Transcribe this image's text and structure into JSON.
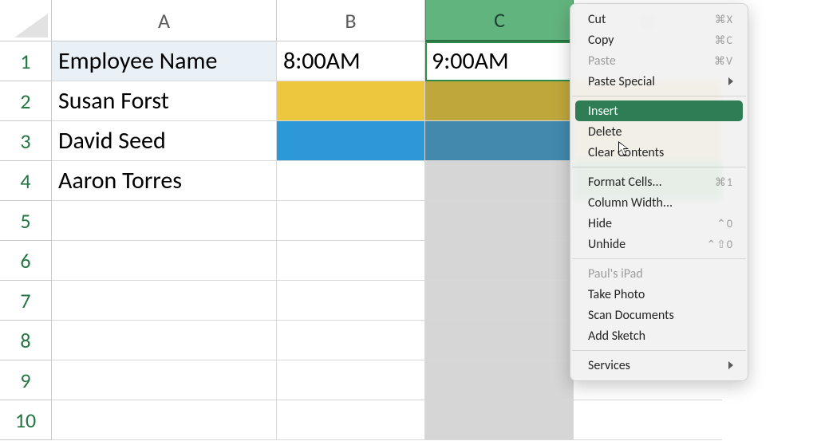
{
  "columns": {
    "A": "A",
    "B": "B",
    "C": "C",
    "D": "D"
  },
  "rows": {
    "r1": "1",
    "r2": "2",
    "r3": "3",
    "r4": "4",
    "r5": "5",
    "r6": "6",
    "r7": "7",
    "r8": "8",
    "r9": "9",
    "r10": "10"
  },
  "header_row": {
    "A": "Employee Name",
    "B": "8:00AM",
    "C": "9:00AM",
    "D": ""
  },
  "employees": {
    "r2": "Susan Forst",
    "r3": "David Seed",
    "r4": "Aaron Torres"
  },
  "selected_column": "C",
  "context_menu": {
    "cut": {
      "label": "Cut",
      "shortcut": "⌘X"
    },
    "copy": {
      "label": "Copy",
      "shortcut": "⌘C"
    },
    "paste": {
      "label": "Paste",
      "shortcut": "⌘V",
      "disabled": true
    },
    "paste_special": {
      "label": "Paste Special",
      "submenu": true
    },
    "insert": {
      "label": "Insert",
      "highlight": true
    },
    "delete": {
      "label": "Delete"
    },
    "clear_contents": {
      "label": "Clear Contents"
    },
    "format_cells": {
      "label": "Format Cells...",
      "shortcut": "⌘1"
    },
    "column_width": {
      "label": "Column Width..."
    },
    "hide": {
      "label": "Hide",
      "shortcut": "⌃0"
    },
    "unhide": {
      "label": "Unhide",
      "shortcut": "⌃⇧0"
    },
    "device_header": {
      "label": "Paul's iPad",
      "disabled": true
    },
    "take_photo": {
      "label": "Take Photo"
    },
    "scan_docs": {
      "label": "Scan Documents"
    },
    "add_sketch": {
      "label": "Add Sketch"
    },
    "services": {
      "label": "Services",
      "submenu": true
    }
  }
}
